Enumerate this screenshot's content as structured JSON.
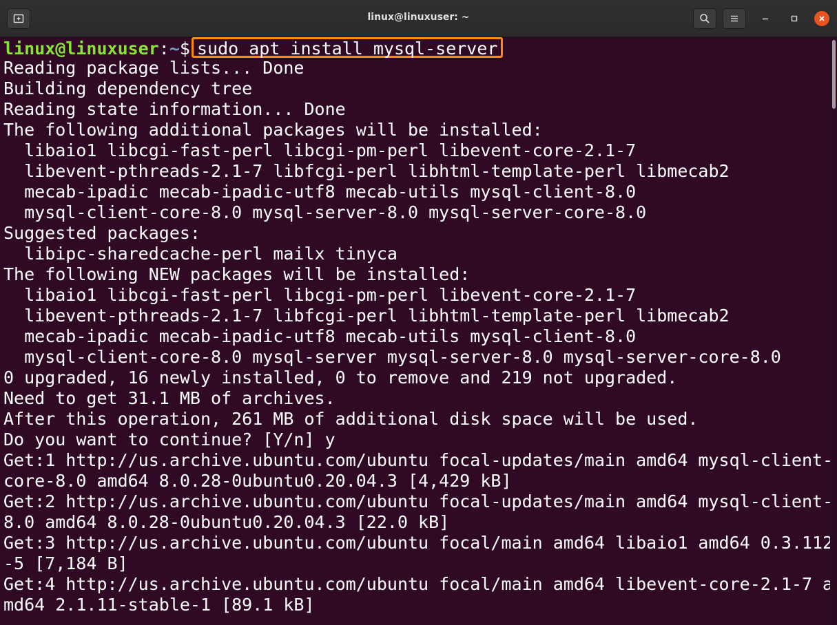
{
  "window": {
    "title": "linux@linuxuser: ~"
  },
  "icons": {
    "new_tab": "new-tab-icon",
    "search": "search-icon",
    "menu": "hamburger-menu-icon",
    "minimize": "minimize-icon",
    "maximize": "maximize-icon",
    "close": "close-icon"
  },
  "colors": {
    "background": "#300a24",
    "prompt_user": "#8ae234",
    "prompt_path": "#729fcf",
    "highlight_box": "#ff8c00",
    "close_button": "#e95420"
  },
  "prompt": {
    "user_host": "linux@linuxuser",
    "separator": ":",
    "path": "~",
    "symbol": "$",
    "command": "sudo apt install mysql-server"
  },
  "output": [
    "Reading package lists... Done",
    "Building dependency tree",
    "Reading state information... Done",
    "The following additional packages will be installed:",
    "  libaio1 libcgi-fast-perl libcgi-pm-perl libevent-core-2.1-7",
    "  libevent-pthreads-2.1-7 libfcgi-perl libhtml-template-perl libmecab2",
    "  mecab-ipadic mecab-ipadic-utf8 mecab-utils mysql-client-8.0",
    "  mysql-client-core-8.0 mysql-server-8.0 mysql-server-core-8.0",
    "Suggested packages:",
    "  libipc-sharedcache-perl mailx tinyca",
    "The following NEW packages will be installed:",
    "  libaio1 libcgi-fast-perl libcgi-pm-perl libevent-core-2.1-7",
    "  libevent-pthreads-2.1-7 libfcgi-perl libhtml-template-perl libmecab2",
    "  mecab-ipadic mecab-ipadic-utf8 mecab-utils mysql-client-8.0",
    "  mysql-client-core-8.0 mysql-server mysql-server-8.0 mysql-server-core-8.0",
    "0 upgraded, 16 newly installed, 0 to remove and 219 not upgraded.",
    "Need to get 31.1 MB of archives.",
    "After this operation, 261 MB of additional disk space will be used.",
    "Do you want to continue? [Y/n] y",
    "Get:1 http://us.archive.ubuntu.com/ubuntu focal-updates/main amd64 mysql-client-",
    "core-8.0 amd64 8.0.28-0ubuntu0.20.04.3 [4,429 kB]",
    "Get:2 http://us.archive.ubuntu.com/ubuntu focal-updates/main amd64 mysql-client-",
    "8.0 amd64 8.0.28-0ubuntu0.20.04.3 [22.0 kB]",
    "Get:3 http://us.archive.ubuntu.com/ubuntu focal/main amd64 libaio1 amd64 0.3.112",
    "-5 [7,184 B]",
    "Get:4 http://us.archive.ubuntu.com/ubuntu focal/main amd64 libevent-core-2.1-7 a",
    "md64 2.1.11-stable-1 [89.1 kB]"
  ]
}
